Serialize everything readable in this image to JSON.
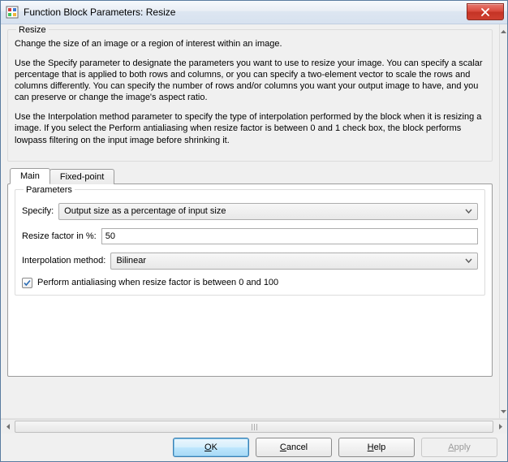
{
  "window": {
    "title": "Function Block Parameters: Resize"
  },
  "group": {
    "title": "Resize"
  },
  "description": {
    "p1": "Change the size of an image or a region of interest within an image.",
    "p2": "Use the Specify parameter to designate the parameters you want to use to resize your image. You can specify a scalar percentage that is applied to both rows and columns, or you can specify a two-element vector to scale the rows and columns differently. You can specify the number of rows and/or columns you want your output image to have, and you can preserve or change the image's aspect ratio.",
    "p3": "Use the Interpolation method parameter to specify the type of interpolation performed by the block when it is resizing a image. If you select the Perform antialiasing when resize factor is between 0 and 1 check box, the block performs lowpass filtering on the input image before shrinking it."
  },
  "tabs": {
    "main": "Main",
    "fixed": "Fixed-point"
  },
  "params": {
    "group_title": "Parameters",
    "specify_label": "Specify:",
    "specify_value": "Output size as a percentage of input size",
    "resize_label": "Resize factor in %:",
    "resize_value": "50",
    "interp_label": "Interpolation method:",
    "interp_value": "Bilinear",
    "antialias_label": "Perform antialiasing when resize factor is between 0 and 100",
    "antialias_checked": true
  },
  "buttons": {
    "ok_pre": "",
    "ok_mn": "O",
    "ok_post": "K",
    "cancel_pre": "",
    "cancel_mn": "C",
    "cancel_post": "ancel",
    "help_pre": "",
    "help_mn": "H",
    "help_post": "elp",
    "apply_pre": "",
    "apply_mn": "A",
    "apply_post": "pply"
  }
}
